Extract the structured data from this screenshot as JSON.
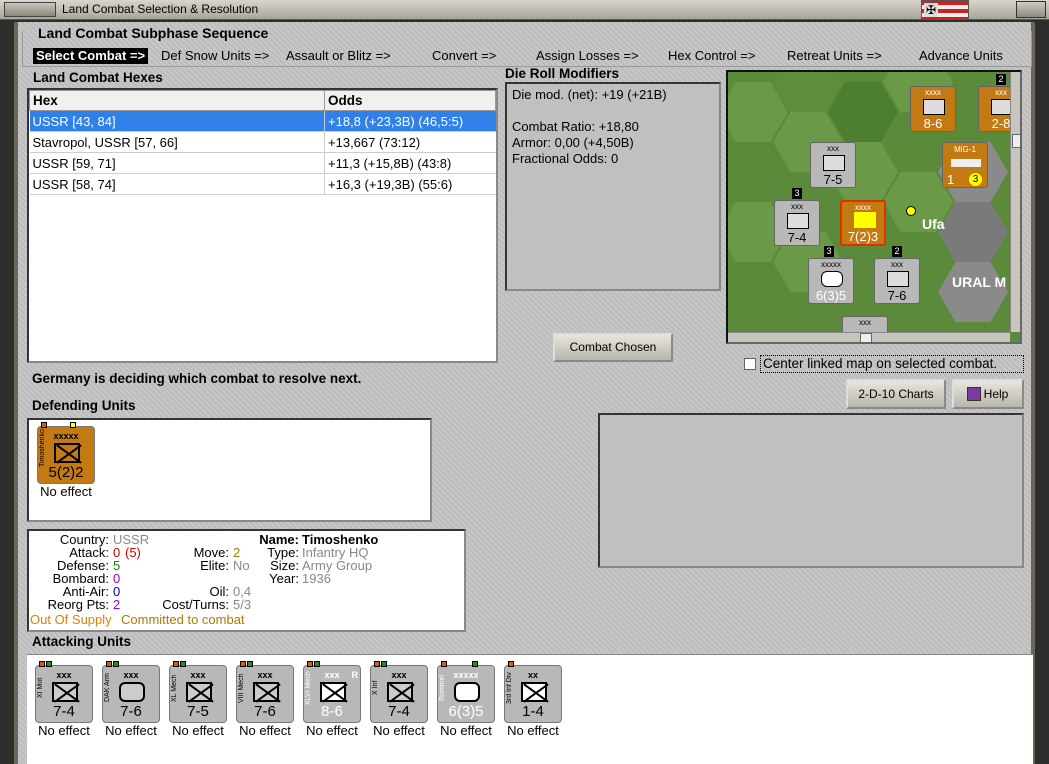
{
  "window": {
    "title": "Land Combat Selection & Resolution"
  },
  "subphase": {
    "title": "Land Combat Subphase Sequence",
    "steps": [
      "Select Combat =>",
      "Def Snow Units =>",
      "Assault or Blitz =>",
      "Convert =>",
      "Assign Losses =>",
      "Hex Control =>",
      "Retreat Units =>",
      "Advance Units"
    ]
  },
  "hexes": {
    "title": "Land Combat Hexes",
    "columns": [
      "Hex",
      "Odds"
    ],
    "rows": [
      {
        "hex": "USSR [43, 84]",
        "odds": "+18,8 (+23,3B) (46,5:5)"
      },
      {
        "hex": "Stavropol, USSR [57, 66]",
        "odds": "+13,667 (73:12)"
      },
      {
        "hex": "USSR [59, 71]",
        "odds": "+11,3 (+15,8B) (43:8)"
      },
      {
        "hex": "USSR [58, 74]",
        "odds": "+16,3 (+19,3B) (55:6)"
      }
    ]
  },
  "drm": {
    "title": "Die Roll Modifiers",
    "lines": [
      "Die mod. (net): +19 (+21B)",
      "",
      "Combat Ratio: +18,80",
      "Armor: 0,00 (+4,50B)",
      "Fractional Odds: 0"
    ]
  },
  "buttons": {
    "combat_chosen": "Combat Chosen",
    "charts": "2-D-10 Charts",
    "help": "Help"
  },
  "center_map": {
    "label": "Center linked map on selected combat."
  },
  "status": "Germany is deciding which combat to resolve next.",
  "defending": {
    "title": "Defending Units",
    "units": [
      {
        "name": "Timoshenko",
        "size": "xxxxx",
        "value": "5(2)2",
        "effect": "No effect"
      }
    ]
  },
  "details": {
    "country_label": "Country:",
    "country": "USSR",
    "attack_label": "Attack:",
    "attack": "0",
    "attack_extra": "(5)",
    "defense_label": "Defense:",
    "defense": "5",
    "bombard_label": "Bombard:",
    "bombard": "0",
    "antiair_label": "Anti-Air:",
    "antiair": "0",
    "reorg_label": "Reorg Pts:",
    "reorg": "2",
    "move_label": "Move:",
    "move": "2",
    "elite_label": "Elite:",
    "elite": "No",
    "oil_label": "Oil:",
    "oil": "0,4",
    "cost_label": "Cost/Turns:",
    "cost": "5/3",
    "name_label": "Name:",
    "name": "Timoshenko",
    "type_label": "Type:",
    "type": "Infantry HQ",
    "size_label": "Size:",
    "size": "Army Group",
    "year_label": "Year:",
    "year": "1936",
    "supply": "Out Of Supply",
    "committed": "Committed to combat"
  },
  "attacking": {
    "title": "Attacking Units",
    "units": [
      {
        "name": "XI Mot",
        "size": "xxx",
        "value": "7-4",
        "effect": "No effect"
      },
      {
        "name": "DAK Arm",
        "size": "xxx",
        "value": "7-6",
        "effect": "No effect"
      },
      {
        "name": "XL Mech",
        "size": "xxx",
        "value": "7-5",
        "effect": "No effect"
      },
      {
        "name": "VIII Mech",
        "size": "xxx",
        "value": "7-6",
        "effect": "No effect"
      },
      {
        "name": "XLVI Mech",
        "size": "xxx",
        "value": "8-6",
        "effect": "No effect",
        "flag": "R"
      },
      {
        "name": "X Inf",
        "size": "xxx",
        "value": "7-4",
        "effect": "No effect"
      },
      {
        "name": "Rommel",
        "size": "xxxxx",
        "value": "6(3)5",
        "effect": "No effect"
      },
      {
        "name": "3rd Inf Div",
        "size": "xx",
        "value": "1-4",
        "effect": "No effect"
      }
    ]
  },
  "map": {
    "city": "Ufa",
    "region": "URAL M",
    "counters": [
      {
        "size": "xxx",
        "value": "7-5"
      },
      {
        "size": "xxx",
        "value": "7-4"
      },
      {
        "size": "xxxx",
        "value": "7(2)3"
      },
      {
        "size": "xxxxx",
        "value": "6(3)5"
      },
      {
        "size": "xxx",
        "value": "7-6"
      },
      {
        "size": "xxxx",
        "value": "8-6"
      },
      {
        "size": "xxx",
        "value": "2-8"
      },
      {
        "size": "MiG-1",
        "value": "1",
        "extra": "3"
      },
      {
        "size": "xxx",
        "value": ""
      }
    ],
    "stack_badges": [
      "3",
      "3",
      "2",
      "2"
    ]
  }
}
